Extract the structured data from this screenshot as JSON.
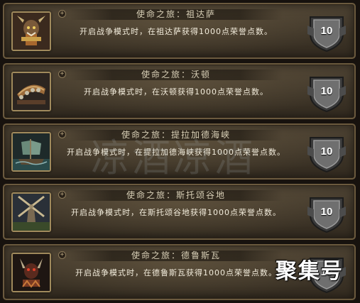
{
  "achievements": [
    {
      "title": "使命之旅：祖达萨",
      "description": "开启战争模式时，在祖达萨获得1000点荣誉点数。",
      "points": "10",
      "icon": "zandalari-troll-icon",
      "expand_symbol": "+"
    },
    {
      "title": "使命之旅：沃顿",
      "description": "开启战争模式时，在沃顿获得1000点荣誉点数。",
      "points": "10",
      "icon": "hunting-horn-icon",
      "expand_symbol": "+"
    },
    {
      "title": "使命之旅：提拉加德海峡",
      "description": "开启战争模式时，在提拉加德海峡获得1000点荣誉点数。",
      "points": "10",
      "icon": "sailing-ship-icon",
      "expand_symbol": "+"
    },
    {
      "title": "使命之旅：斯托颂谷地",
      "description": "开启战争模式时，在斯托颂谷地获得1000点荣誉点数。",
      "points": "10",
      "icon": "windmill-icon",
      "expand_symbol": "+"
    },
    {
      "title": "使命之旅：德鲁斯瓦",
      "description": "开启战争模式时，在德鲁斯瓦获得1000点荣誉点数。",
      "points": "10",
      "icon": "drust-totem-icon",
      "expand_symbol": "+"
    }
  ],
  "watermark": "凉酒凉酒",
  "source_mark": "聚集号",
  "colors": {
    "row_border": "#6b5a3e",
    "title_text": "#d8cfb6",
    "description_text": "#f2ecdc",
    "shield": "#6f6f6f"
  }
}
